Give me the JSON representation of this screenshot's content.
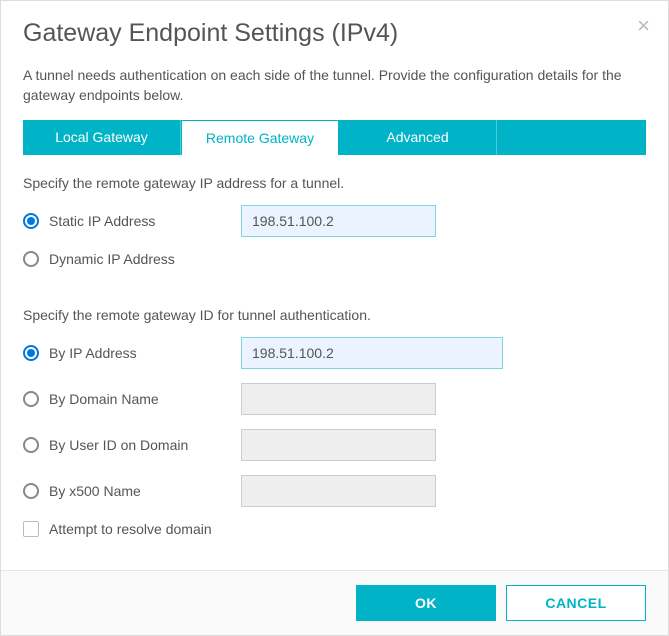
{
  "dialog": {
    "title": "Gateway Endpoint Settings (IPv4)",
    "close_symbol": "×",
    "description": "A tunnel needs authentication on each side of the tunnel. Provide the configuration details for the gateway endpoints below."
  },
  "tabs": {
    "local": "Local Gateway",
    "remote": "Remote Gateway",
    "advanced": "Advanced"
  },
  "ip_section": {
    "heading": "Specify the remote gateway IP address for a tunnel.",
    "static_label": "Static IP Address",
    "static_value": "198.51.100.2",
    "dynamic_label": "Dynamic IP Address"
  },
  "id_section": {
    "heading": "Specify the remote gateway ID for tunnel authentication.",
    "by_ip_label": "By IP Address",
    "by_ip_value": "198.51.100.2",
    "by_domain_label": "By Domain Name",
    "by_domain_value": "",
    "by_userid_label": "By User ID on Domain",
    "by_userid_value": "",
    "by_x500_label": "By x500 Name",
    "by_x500_value": "",
    "resolve_label": "Attempt to resolve domain"
  },
  "buttons": {
    "ok": "OK",
    "cancel": "CANCEL"
  }
}
